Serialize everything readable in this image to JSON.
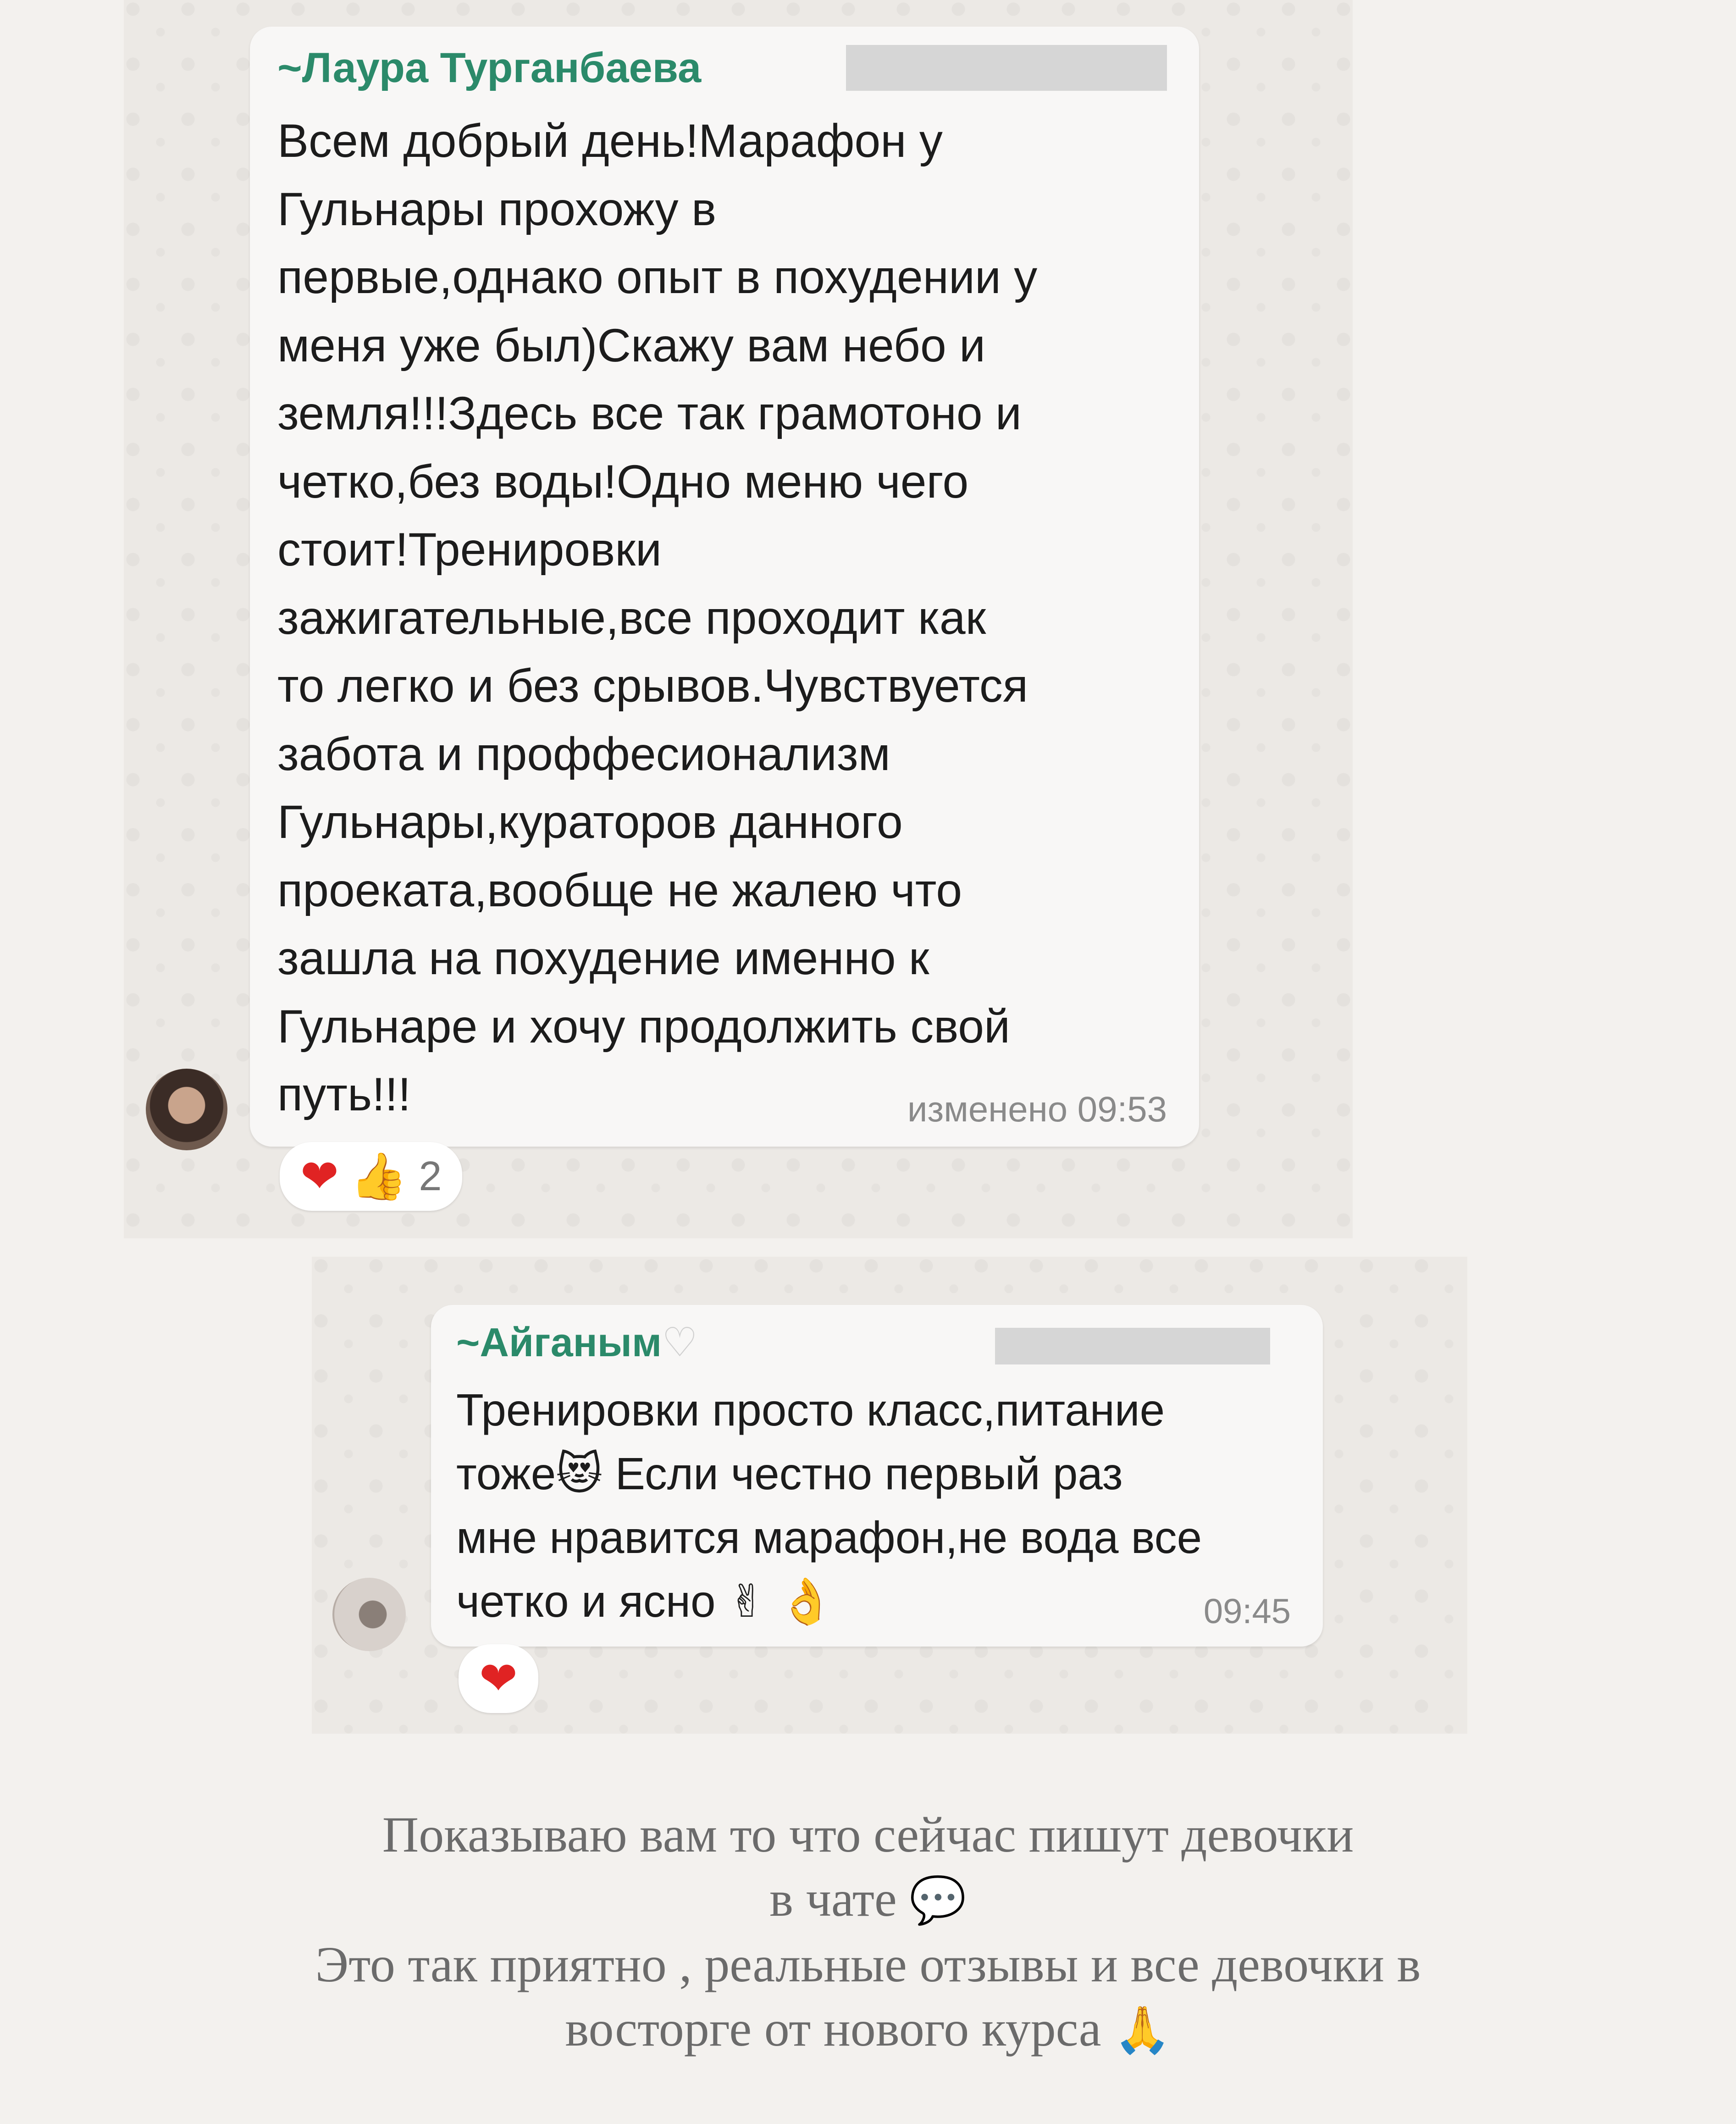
{
  "messages": [
    {
      "sender": "~Лаура Турганбаева",
      "text": "Всем добрый день!Марафон у\nГульнары прохожу в\nпервые,однако опыт в похудении у\nменя уже был)Скажу вам небо и\nземля!!!Здесь все так грамотоно и\nчетко,без воды!Одно меню чего\nстоит!Тренировки\nзажигательные,все проходит как\nто легко и без срывов.Чувствуется\nзабота и проффесионализм\nГульнары,кураторов данного\nпроеката,вообще не жалею что\nзашла на похудение именно к\nГульнаре и хочу продолжить свой\nпуть!!!",
      "meta": "изменено 09:53",
      "reactions": {
        "emoji1": "❤",
        "emoji2": "👍",
        "count": "2"
      }
    },
    {
      "sender": "~Айганым",
      "sender_emoji": "♡",
      "text": "Тренировки просто класс,питание\nтоже😻 Если честно первый раз\nмне нравится марафон,не вода все\nчетко и ясно ✌ 👌",
      "meta": "09:45",
      "reactions": {
        "emoji1": "❤"
      }
    }
  ],
  "caption": {
    "line1": "Показываю вам то что сейчас пишут девочки",
    "line2": "в чате",
    "line2_icon": "💬",
    "line3": "Это так приятно , реальные отзывы и все девочки в",
    "line4": "восторге от нового курса",
    "line4_icon": "🙏"
  }
}
